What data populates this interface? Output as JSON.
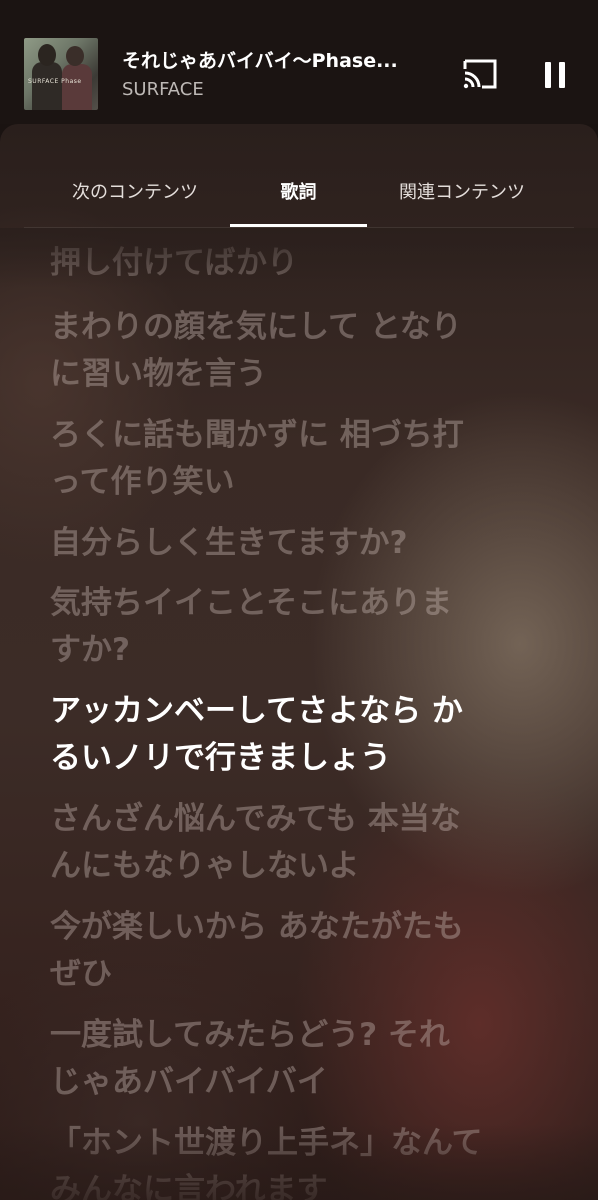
{
  "now_playing": {
    "title": "それじゃあバイバイ〜Phase...",
    "artist": "SURFACE",
    "album_art_text": "SURFACE Phase"
  },
  "controls": {
    "cast_icon": "cast-icon",
    "pause_icon": "pause-icon"
  },
  "tabs": [
    {
      "label": "次のコンテンツ",
      "active": false
    },
    {
      "label": "歌詞",
      "active": true
    },
    {
      "label": "関連コンテンツ",
      "active": false
    }
  ],
  "lyrics": [
    {
      "lines": [
        "押し付けてばかり"
      ],
      "current": false
    },
    {
      "lines": [
        "まわりの顔を気にして となり",
        "に習い物を言う"
      ],
      "current": false
    },
    {
      "lines": [
        "ろくに話も聞かずに 相づち打",
        "って作り笑い"
      ],
      "current": false
    },
    {
      "lines": [
        "自分らしく生きてますか?"
      ],
      "current": false
    },
    {
      "lines": [
        "気持ちイイことそこにありま",
        "すか?"
      ],
      "current": false
    },
    {
      "lines": [
        "アッカンベーしてさよなら か",
        "るいノリで行きましょう"
      ],
      "current": true
    },
    {
      "lines": [
        "さんざん悩んでみても 本当な",
        "んにもなりゃしないよ"
      ],
      "current": false
    },
    {
      "lines": [
        "今が楽しいから あなたがたも",
        "ぜひ"
      ],
      "current": false
    },
    {
      "lines": [
        "一度試してみたらどう? それ",
        "じゃあバイバイバイ"
      ],
      "current": false
    },
    {
      "lines": [
        "「ホント世渡り上手ネ」なんて",
        "みんなに言われます"
      ],
      "current": false
    }
  ],
  "colors": {
    "background": "#1a1311",
    "current_lyric": "#ffffff",
    "dim_lyric": "rgba(205,190,185,0.38)"
  }
}
